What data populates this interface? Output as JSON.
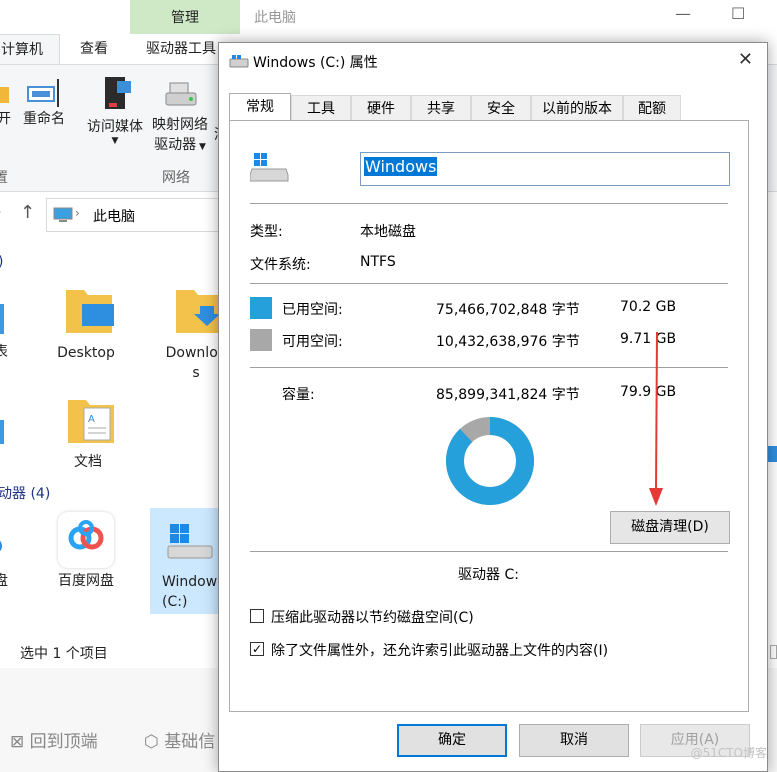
{
  "explorer": {
    "title": "此电脑",
    "manage_tab": "管理",
    "ribbon_tabs": [
      "计算机",
      "查看",
      "驱动器工具"
    ],
    "ribbon": {
      "open_label": "开",
      "rename_label": "重命名",
      "access_media_label": "访问媒体",
      "map_drive_line1": "映射网络",
      "map_drive_line2": "驱动器",
      "add_location_label": "添",
      "group_network": "网络",
      "group_left": "置"
    },
    "address": "此电脑",
    "sections": {
      "folders_suffix": ")",
      "devices": "动器 (4)"
    },
    "folders": [
      "Desktop",
      "Downloa\ns",
      "文档"
    ],
    "drives": [
      "盘",
      "百度网盘",
      "Window\n(C:)"
    ],
    "left_partial": [
      "表",
      "盘"
    ],
    "status": "选中 1 个项目",
    "footer": {
      "back_to_top": "回到顶端",
      "basic": "基础信"
    }
  },
  "dialog": {
    "title": "Windows (C:) 属性",
    "tabs": [
      "常规",
      "工具",
      "硬件",
      "共享",
      "安全",
      "以前的版本",
      "配额"
    ],
    "active_tab": "常规",
    "name_value": "Windows",
    "type_label": "类型:",
    "type_value": "本地磁盘",
    "fs_label": "文件系统:",
    "fs_value": "NTFS",
    "used_label": "已用空间:",
    "used_bytes": "75,466,702,848 字节",
    "used_gb": "70.2 GB",
    "free_label": "可用空间:",
    "free_bytes": "10,432,638,976 字节",
    "free_gb": "9.71 GB",
    "capacity_label": "容量:",
    "capacity_bytes": "85,899,341,824 字节",
    "capacity_gb": "79.9 GB",
    "drive_label": "驱动器 C:",
    "cleanup_button": "磁盘清理(D)",
    "compress_label": "压缩此驱动器以节约磁盘空间(C)",
    "compress_checked": false,
    "index_label": "除了文件属性外，还允许索引此驱动器上文件的内容(I)",
    "index_checked": true,
    "ok_button": "确定",
    "cancel_button": "取消",
    "apply_button": "应用(A)",
    "used_fraction": 0.879,
    "colors": {
      "used": "#26a0da",
      "free": "#a8a8a8",
      "accent": "#0078d7",
      "annotation_arrow": "#e53935"
    }
  },
  "watermark": "@51CTO博客"
}
